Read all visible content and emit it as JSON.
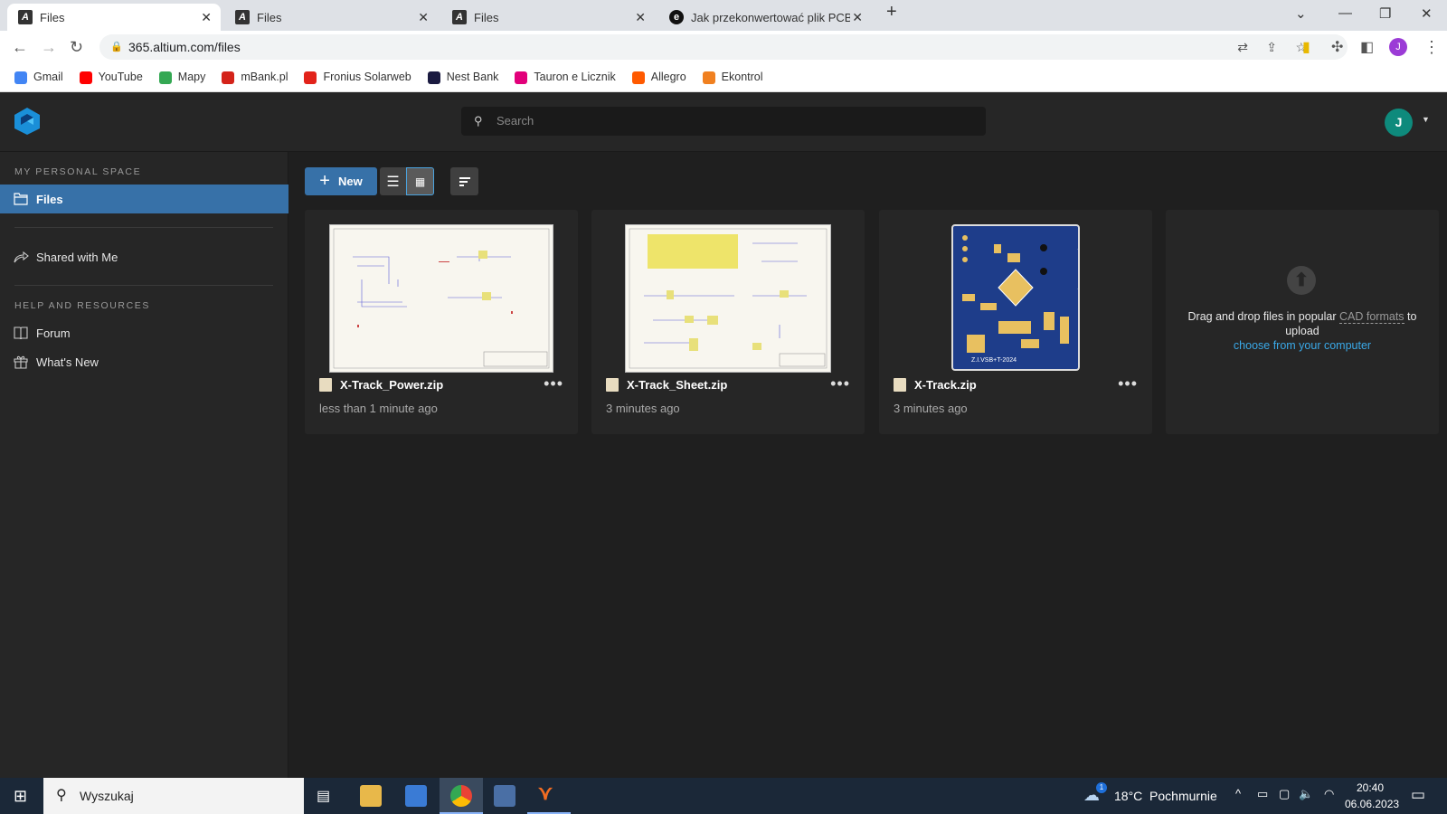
{
  "browser": {
    "tabs": [
      {
        "title": "Files",
        "active": true
      },
      {
        "title": "Files"
      },
      {
        "title": "Files"
      },
      {
        "title": "Jak przekonwertować plik PCBDC"
      }
    ],
    "url": "365.altium.com/files",
    "profile_initial": "J",
    "bookmarks": [
      {
        "label": "Gmail",
        "color": "#4285f4"
      },
      {
        "label": "YouTube",
        "color": "#ff0000"
      },
      {
        "label": "Mapy",
        "color": "#34a853"
      },
      {
        "label": "mBank.pl",
        "color": "#d4231a"
      },
      {
        "label": "Fronius Solarweb",
        "color": "#e2231a"
      },
      {
        "label": "Nest Bank",
        "color": "#1a1a40"
      },
      {
        "label": "Tauron e Licznik",
        "color": "#e2007a"
      },
      {
        "label": "Allegro",
        "color": "#ff5a00"
      },
      {
        "label": "Ekontrol",
        "color": "#f08020"
      }
    ]
  },
  "app": {
    "search_placeholder": "Search",
    "user_initial": "J",
    "sidebar": {
      "section_personal": "MY PERSONAL SPACE",
      "files": "Files",
      "shared": "Shared with Me",
      "section_help": "HELP AND RESOURCES",
      "forum": "Forum",
      "whats_new": "What's New"
    },
    "toolbar": {
      "new_label": "New",
      "view_mode": "grid"
    },
    "files": [
      {
        "name": "X-Track_Power.zip",
        "time": "less than 1 minute ago",
        "preview": "schematic"
      },
      {
        "name": "X-Track_Sheet.zip",
        "time": "3 minutes ago",
        "preview": "schematic"
      },
      {
        "name": "X-Track.zip",
        "time": "3 minutes ago",
        "preview": "pcb"
      }
    ],
    "upload": {
      "text_before": "Drag and drop files in popular",
      "formats_link": "CAD formats",
      "text_after": "to upload",
      "choose_link": "choose from your computer"
    },
    "accent": "#3771a8"
  },
  "taskbar": {
    "search": "Wyszukaj",
    "weather": "18°C  Pochmurnie",
    "weather_badge": "1",
    "time": "20:40",
    "date": "06.06.2023"
  }
}
